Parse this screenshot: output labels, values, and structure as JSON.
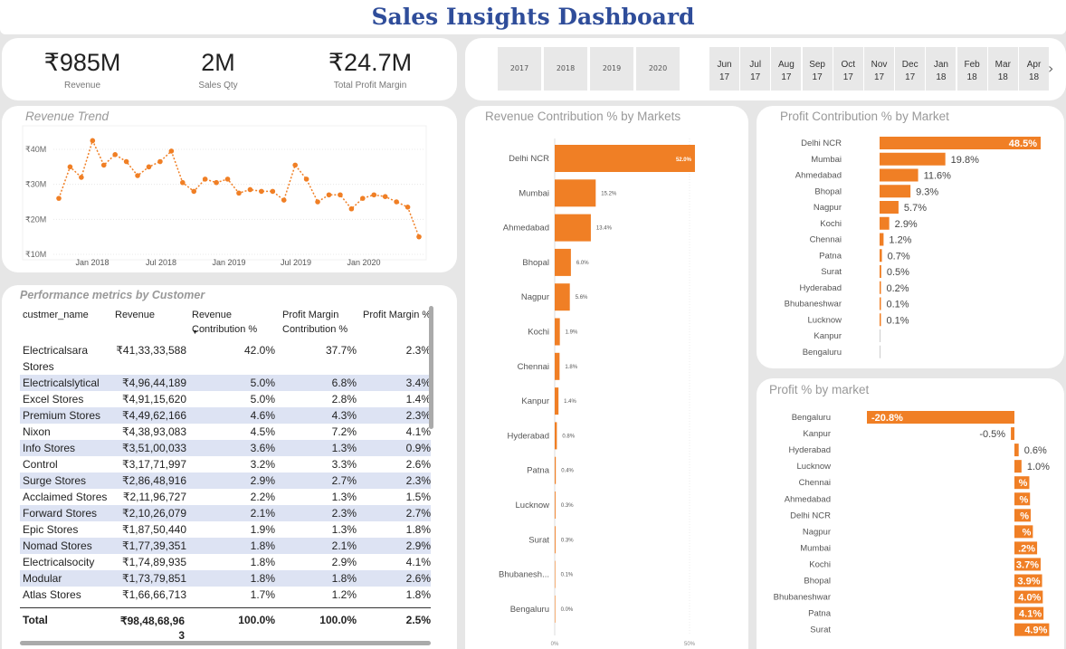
{
  "title": "Sales Insights Dashboard",
  "kpis": [
    {
      "value": "₹985M",
      "label": "Revenue"
    },
    {
      "value": "2M",
      "label": "Sales Qty"
    },
    {
      "value": "₹24.7M",
      "label": "Total Profit Margin"
    }
  ],
  "years": [
    "2017",
    "2018",
    "2019",
    "2020"
  ],
  "months": [
    {
      "m": "Jun",
      "y": "17"
    },
    {
      "m": "Jul",
      "y": "17"
    },
    {
      "m": "Aug",
      "y": "17"
    },
    {
      "m": "Sep",
      "y": "17"
    },
    {
      "m": "Oct",
      "y": "17"
    },
    {
      "m": "Nov",
      "y": "17"
    },
    {
      "m": "Dec",
      "y": "17"
    },
    {
      "m": "Jan",
      "y": "18"
    },
    {
      "m": "Feb",
      "y": "18"
    },
    {
      "m": "Mar",
      "y": "18"
    },
    {
      "m": "Apr",
      "y": "18"
    }
  ],
  "colors": {
    "accent": "#f07f25",
    "title": "#2f4d9a",
    "row_alt": "#dde3f3"
  },
  "icons": {
    "next": "chevron-right-icon",
    "sort": "sort-desc-icon"
  },
  "chart_data": [
    {
      "type": "line",
      "title": "Revenue Trend",
      "x_tick_labels": [
        "Jan 2018",
        "Jul 2018",
        "Jan 2019",
        "Jul 2019",
        "Jan 2020"
      ],
      "y_tick_labels": [
        "₹10M",
        "₹20M",
        "₹30M",
        "₹40M"
      ],
      "ylim": [
        9,
        45
      ],
      "series": [
        {
          "values": [
            26,
            35,
            32,
            42.5,
            35.5,
            38.5,
            36.5,
            32.5,
            35,
            36.5,
            39.5,
            30.5,
            28,
            31.5,
            30.5,
            31.5,
            27.5,
            28.5,
            28,
            28,
            25.5,
            35.5,
            31.5,
            25,
            27,
            27,
            23,
            26,
            27,
            26.5,
            25,
            23.5,
            15
          ]
        }
      ]
    },
    {
      "type": "bar",
      "title": "Revenue Contribution % by Markets",
      "categories": [
        "Delhi NCR",
        "Mumbai",
        "Ahmedabad",
        "Bhopal",
        "Nagpur",
        "Kochi",
        "Chennai",
        "Kanpur",
        "Hyderabad",
        "Patna",
        "Lucknow",
        "Surat",
        "Bhubanesh...",
        "Bengaluru"
      ],
      "values": [
        52.0,
        15.2,
        13.4,
        6.0,
        5.6,
        1.9,
        1.8,
        1.4,
        0.8,
        0.4,
        0.3,
        0.3,
        0.1,
        0.0
      ],
      "labels": [
        "52.0%",
        "15.2%",
        "13.4%",
        "6.0%",
        "5.6%",
        "1.9%",
        "1.8%",
        "1.4%",
        "0.8%",
        "0.4%",
        "0.3%",
        "0.3%",
        "0.1%",
        "0.0%"
      ],
      "x_tick_labels": [
        "0%",
        "50%"
      ],
      "xlim": [
        0,
        50
      ]
    },
    {
      "type": "bar",
      "title": "Profit Contribution % by Market",
      "categories": [
        "Delhi NCR",
        "Mumbai",
        "Ahmedabad",
        "Bhopal",
        "Nagpur",
        "Kochi",
        "Chennai",
        "Patna",
        "Surat",
        "Hyderabad",
        "Bhubaneshwar",
        "Lucknow",
        "Kanpur",
        "Bengaluru"
      ],
      "values": [
        48.5,
        19.8,
        11.6,
        9.3,
        5.7,
        2.9,
        1.2,
        0.7,
        0.5,
        0.2,
        0.1,
        0.1,
        0,
        0
      ],
      "labels": [
        "48.5%",
        "19.8%",
        "11.6%",
        "9.3%",
        "5.7%",
        "2.9%",
        "1.2%",
        "0.7%",
        "0.5%",
        "0.2%",
        "0.1%",
        "0.1%",
        "",
        ""
      ]
    },
    {
      "type": "bar",
      "title": "Profit % by market",
      "categories": [
        "Bengaluru",
        "Kanpur",
        "Hyderabad",
        "Lucknow",
        "Chennai",
        "Ahmedabad",
        "Delhi NCR",
        "Nagpur",
        "Mumbai",
        "Kochi",
        "Bhopal",
        "Bhubaneshwar",
        "Patna",
        "Surat"
      ],
      "values": [
        -20.8,
        -0.5,
        0.6,
        1.0,
        2.1,
        2.2,
        2.3,
        2.6,
        3.2,
        3.7,
        3.9,
        4.0,
        4.1,
        4.9
      ],
      "labels": [
        "-20.8%",
        "-0.5%",
        "0.6%",
        "1.0%",
        "%",
        "%",
        "%",
        "%",
        ".2%",
        "3.7%",
        "3.9%",
        "4.0%",
        "4.1%",
        "4.9%"
      ]
    }
  ],
  "customer_table": {
    "title": "Performance metrics by Customer",
    "headers": [
      {
        "l1": "custmer_name",
        "l2": ""
      },
      {
        "l1": "Revenue",
        "l2": ""
      },
      {
        "l1": "Revenue",
        "l2": "Contribution %"
      },
      {
        "l1": "Profit Margin",
        "l2": "Contribution %"
      },
      {
        "l1": "Profit Margin %",
        "l2": ""
      }
    ],
    "rows": [
      {
        "name": "Electricalsara",
        "name2": "Stores",
        "rev": "₹41,33,33,588",
        "rc": "42.0%",
        "pmc": "37.7%",
        "pm": "2.3%"
      },
      {
        "name": "Electricalslytical",
        "rev": "₹4,96,44,189",
        "rc": "5.0%",
        "pmc": "6.8%",
        "pm": "3.4%"
      },
      {
        "name": "Excel Stores",
        "rev": "₹4,91,15,620",
        "rc": "5.0%",
        "pmc": "2.8%",
        "pm": "1.4%"
      },
      {
        "name": "Premium Stores",
        "rev": "₹4,49,62,166",
        "rc": "4.6%",
        "pmc": "4.3%",
        "pm": "2.3%"
      },
      {
        "name": "Nixon",
        "rev": "₹4,38,93,083",
        "rc": "4.5%",
        "pmc": "7.2%",
        "pm": "4.1%"
      },
      {
        "name": "Info Stores",
        "rev": "₹3,51,00,033",
        "rc": "3.6%",
        "pmc": "1.3%",
        "pm": "0.9%"
      },
      {
        "name": "Control",
        "rev": "₹3,17,71,997",
        "rc": "3.2%",
        "pmc": "3.3%",
        "pm": "2.6%"
      },
      {
        "name": "Surge Stores",
        "rev": "₹2,86,48,916",
        "rc": "2.9%",
        "pmc": "2.7%",
        "pm": "2.3%"
      },
      {
        "name": "Acclaimed Stores",
        "rev": "₹2,11,96,727",
        "rc": "2.2%",
        "pmc": "1.3%",
        "pm": "1.5%"
      },
      {
        "name": "Forward Stores",
        "rev": "₹2,10,26,079",
        "rc": "2.1%",
        "pmc": "2.3%",
        "pm": "2.7%"
      },
      {
        "name": "Epic Stores",
        "rev": "₹1,87,50,440",
        "rc": "1.9%",
        "pmc": "1.3%",
        "pm": "1.8%"
      },
      {
        "name": "Nomad Stores",
        "rev": "₹1,77,39,351",
        "rc": "1.8%",
        "pmc": "2.1%",
        "pm": "2.9%"
      },
      {
        "name": "Electricalsocity",
        "rev": "₹1,74,89,935",
        "rc": "1.8%",
        "pmc": "2.9%",
        "pm": "4.1%"
      },
      {
        "name": "Modular",
        "rev": "₹1,73,79,851",
        "rc": "1.8%",
        "pmc": "1.8%",
        "pm": "2.6%"
      },
      {
        "name": "Atlas Stores",
        "rev": "₹1,66,66,713",
        "rc": "1.7%",
        "pmc": "1.2%",
        "pm": "1.8%"
      }
    ],
    "total": {
      "name": "Total",
      "rev": "₹98,48,68,963",
      "rc": "100.0%",
      "pmc": "100.0%",
      "pm": "2.5%"
    }
  }
}
